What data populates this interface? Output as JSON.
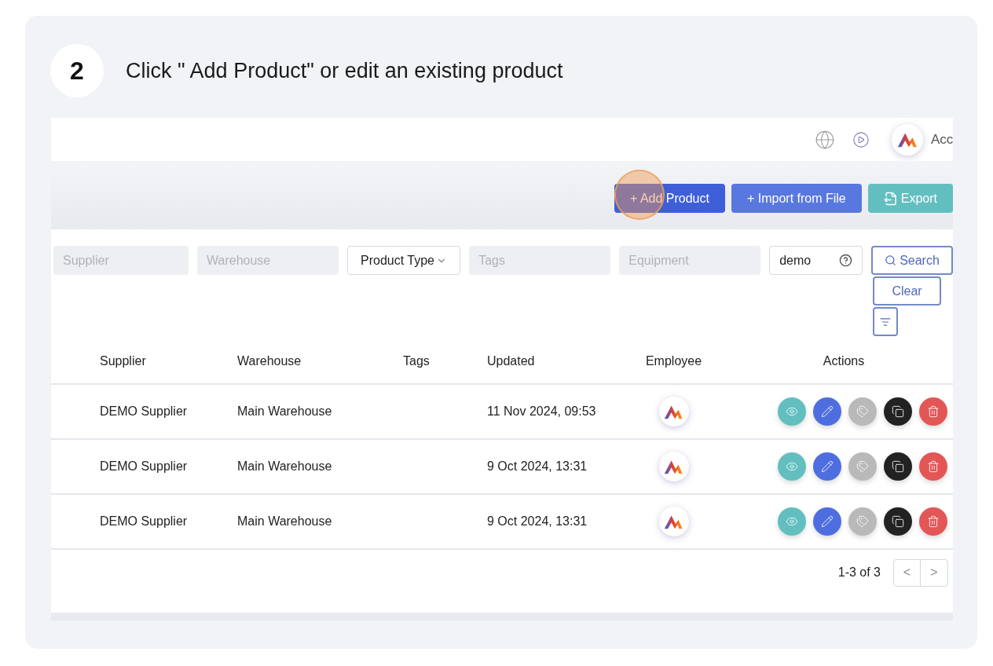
{
  "step": {
    "number": "2",
    "title": "Click \" Add Product\" or edit an existing product"
  },
  "header": {
    "account_label": "Acc"
  },
  "toolbar": {
    "buttons": [
      {
        "kind": "add",
        "label": "+ Add Product",
        "highlighted": true
      },
      {
        "kind": "import",
        "label": "+ Import from File",
        "highlighted": false
      },
      {
        "kind": "export",
        "label": "Export",
        "highlighted": false
      }
    ]
  },
  "filters": [
    {
      "kind": "text",
      "placeholder": "Supplier"
    },
    {
      "kind": "text",
      "placeholder": "Warehouse"
    },
    {
      "kind": "select",
      "value": "Product Type"
    },
    {
      "kind": "text",
      "placeholder": "Tags"
    },
    {
      "kind": "text",
      "placeholder": "Equipment"
    },
    {
      "kind": "search",
      "value": "demo"
    }
  ],
  "filter_buttons": {
    "search": "Search",
    "clear": "Clear"
  },
  "table": {
    "columns": [
      "Supplier",
      "Warehouse",
      "Tags",
      "Updated",
      "Employee",
      "Actions"
    ],
    "rows": [
      {
        "supplier": "DEMO Supplier",
        "warehouse": "Main Warehouse",
        "updated": "11 Nov 2024, 09:53"
      },
      {
        "supplier": "DEMO Supplier",
        "warehouse": "Main Warehouse",
        "updated": "9 Oct 2024, 13:31"
      },
      {
        "supplier": "DEMO Supplier",
        "warehouse": "Main Warehouse",
        "updated": "9 Oct 2024, 13:31"
      }
    ]
  },
  "pagination": {
    "range": "1-3 of 3",
    "prev": "<",
    "next": ">"
  }
}
